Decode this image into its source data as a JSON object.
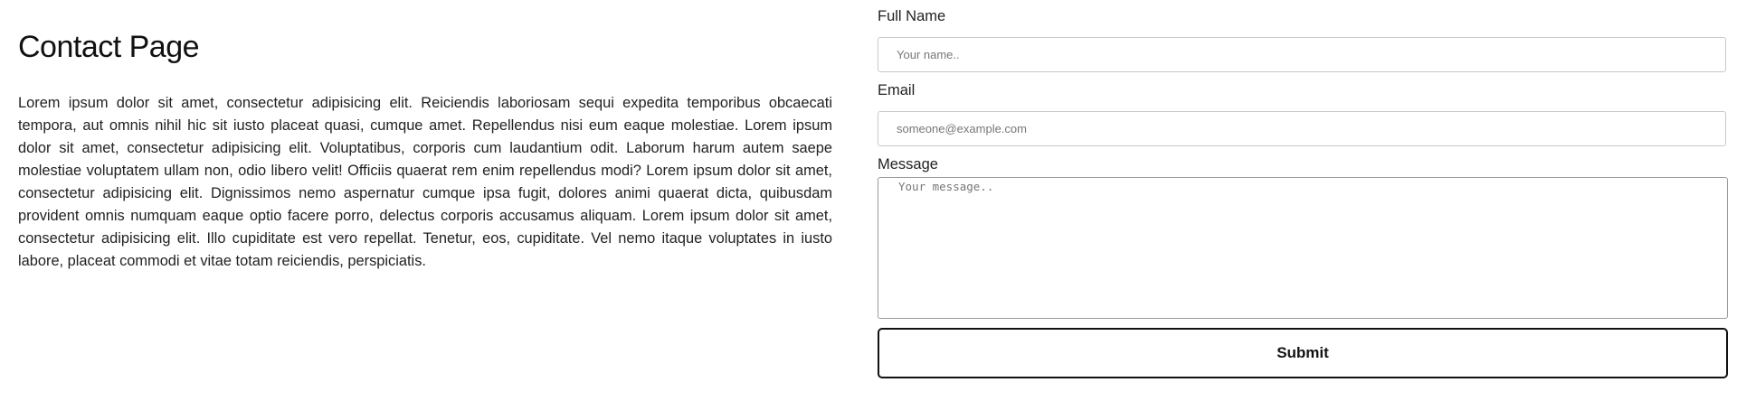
{
  "page": {
    "title": "Contact Page",
    "body": "Lorem ipsum dolor sit amet, consectetur adipisicing elit. Reiciendis laboriosam sequi expedita temporibus obcaecati tempora, aut omnis nihil hic sit iusto placeat quasi, cumque amet. Repellendus nisi eum eaque molestiae. Lorem ipsum dolor sit amet, consectetur adipisicing elit. Voluptatibus, corporis cum laudantium odit. Laborum harum autem saepe molestiae voluptatem ullam non, odio libero velit! Officiis quaerat rem enim repellendus modi? Lorem ipsum dolor sit amet, consectetur adipisicing elit. Dignissimos nemo aspernatur cumque ipsa fugit, dolores animi quaerat dicta, quibusdam provident omnis numquam eaque optio facere porro, delectus corporis accusamus aliquam. Lorem ipsum dolor sit amet, consectetur adipisicing elit. Illo cupiditate est vero repellat. Tenetur, eos, cupiditate. Vel nemo itaque voluptates in iusto labore, placeat commodi et vitae totam reiciendis, perspiciatis."
  },
  "form": {
    "full_name": {
      "label": "Full Name",
      "placeholder": "Your name..",
      "value": ""
    },
    "email": {
      "label": "Email",
      "placeholder": "someone@example.com",
      "value": ""
    },
    "message": {
      "label": "Message",
      "placeholder": "Your message..",
      "value": ""
    },
    "submit_label": "Submit"
  }
}
